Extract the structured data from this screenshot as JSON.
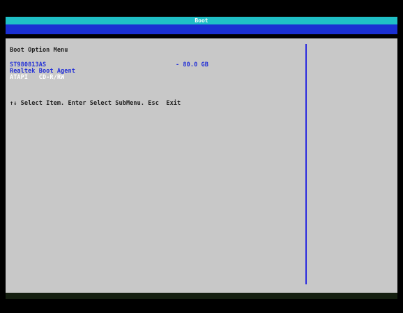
{
  "header": {
    "title": "Boot"
  },
  "menu": {
    "heading": "Boot Option Menu",
    "options": [
      {
        "label": "ST980813AS",
        "size": "- 80.0 GB",
        "selected": false
      },
      {
        "label": "Realtek Boot Agent",
        "size": "",
        "selected": false
      },
      {
        "label": "ATAPI   CD-R/RW",
        "size": "",
        "selected": true
      }
    ]
  },
  "help": {
    "text": "↑↓ Select Item. Enter Select SubMenu. Esc  Exit"
  },
  "colors": {
    "title_bar": "#1fbfc6",
    "blue_strip": "#1a2fd2",
    "panel": "#c8c8c8",
    "option_text": "#2330d6",
    "selected_text": "#ffffff",
    "divider": "#2a2adf"
  }
}
